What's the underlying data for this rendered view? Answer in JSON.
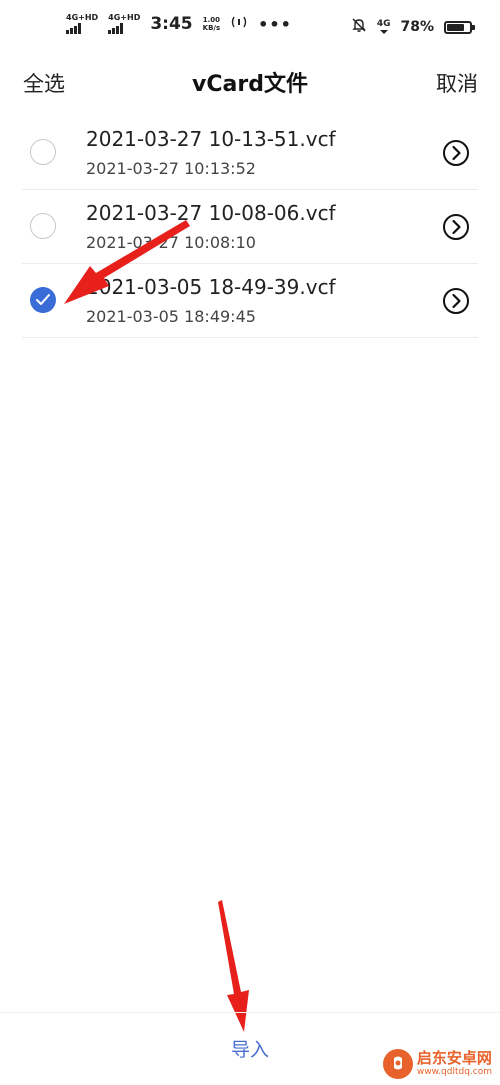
{
  "status_bar": {
    "network_1": "4G+HD",
    "network_2": "4G+HD",
    "time": "3:45",
    "speed_value": "1.00",
    "speed_unit": "KB/s",
    "dots": "•••",
    "network_right": "4G",
    "battery": "78%",
    "battery_level": 0.78
  },
  "header": {
    "select_all": "全选",
    "title": "vCard文件",
    "cancel": "取消"
  },
  "files": [
    {
      "name": "2021-03-27 10-13-51.vcf",
      "date": "2021-03-27 10:13:52",
      "selected": false
    },
    {
      "name": "2021-03-27 10-08-06.vcf",
      "date": "2021-03-27 10:08:10",
      "selected": false
    },
    {
      "name": "2021-03-05 18-49-39.vcf",
      "date": "2021-03-05 18:49:45",
      "selected": true
    }
  ],
  "bottom": {
    "import_label": "导入"
  },
  "watermark": {
    "name": "启东安卓网",
    "url": "www.qdltdq.com"
  },
  "colors": {
    "accent": "#3a6cd8",
    "import_text": "#4a6fd0",
    "annotation": "#e8201c"
  }
}
